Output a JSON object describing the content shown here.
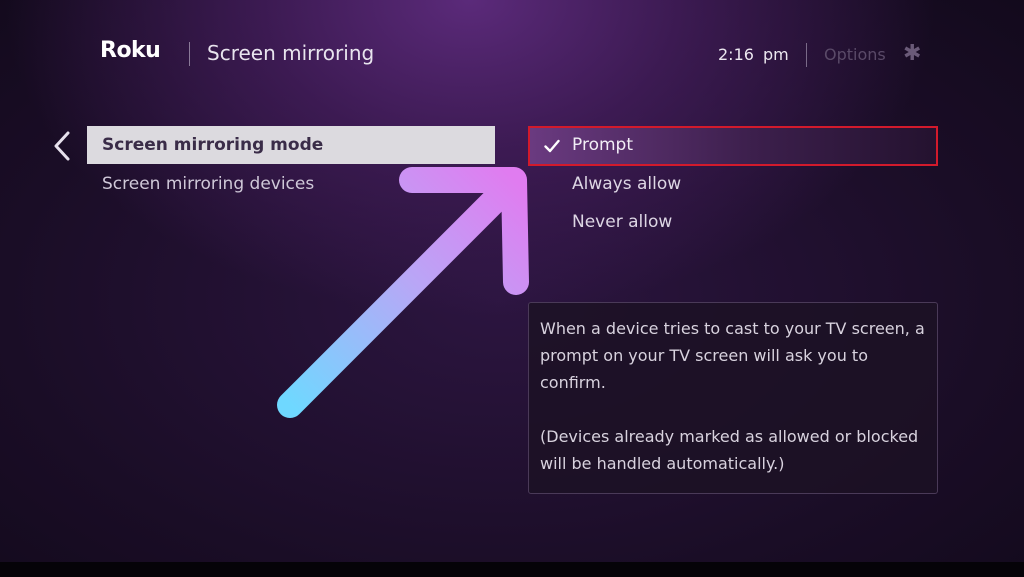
{
  "header": {
    "logo": "Roku",
    "title": "Screen mirroring",
    "time": "2:16 pm",
    "options_label": "Options",
    "options_icon": "asterisk-icon"
  },
  "menu": {
    "back_icon": "chevron-left-icon",
    "items": [
      {
        "label": "Screen mirroring mode",
        "selected": true
      },
      {
        "label": "Screen mirroring devices",
        "selected": false
      }
    ]
  },
  "mode_options": {
    "items": [
      {
        "label": "Prompt",
        "checked": true,
        "highlighted": true
      },
      {
        "label": "Always allow",
        "checked": false
      },
      {
        "label": "Never allow",
        "checked": false
      }
    ],
    "check_icon": "checkmark-icon",
    "highlight_color": "#d21a2c"
  },
  "info": {
    "paragraph_1": "When a device tries to cast to your TV screen, a prompt on your TV screen will ask you to confirm.",
    "paragraph_2": "(Devices already marked as allowed or blocked will be handled automatically.)"
  },
  "annotation": {
    "icon": "pointer-arrow-icon",
    "gradient_start": "#6fd8ff",
    "gradient_end": "#e07cf0"
  }
}
